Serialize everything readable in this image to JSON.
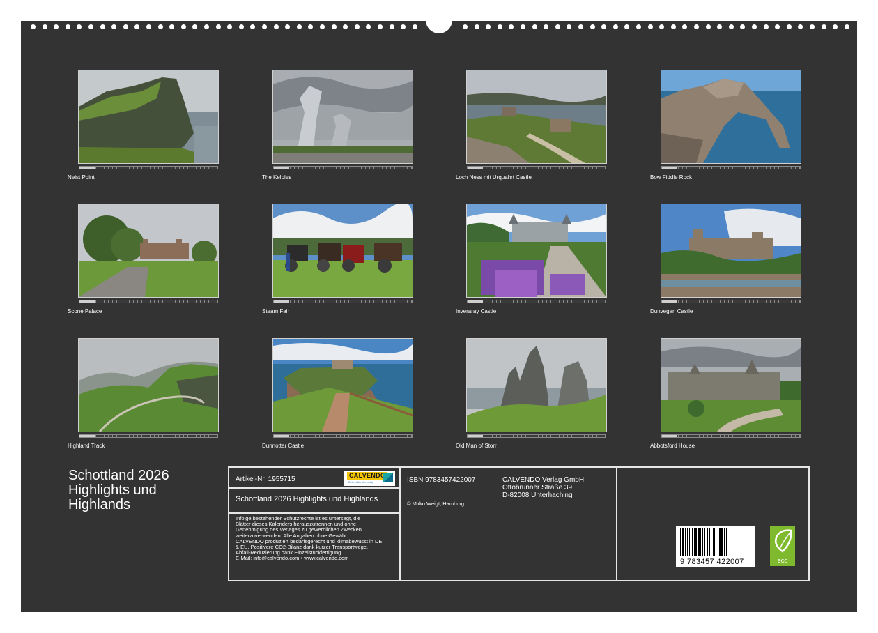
{
  "calendar": {
    "title_lines": [
      "Schottland 2026",
      "Highlights und",
      "Highlands"
    ]
  },
  "months": [
    {
      "caption": "Neist Point"
    },
    {
      "caption": "The Kelpies"
    },
    {
      "caption": "Loch Ness mit Urquahrt Castle"
    },
    {
      "caption": "Bow Fiddle Rock"
    },
    {
      "caption": "Scone Palace"
    },
    {
      "caption": "Steam Fair"
    },
    {
      "caption": "Inveraray Castle"
    },
    {
      "caption": "Dunvegan Castle"
    },
    {
      "caption": "Highland Track"
    },
    {
      "caption": "Dunnottar Castle"
    },
    {
      "caption": "Old Man of Storr"
    },
    {
      "caption": "Abbotsford House"
    }
  ],
  "imprint": {
    "article_no": "Artikel-Nr. 1955715",
    "product_title": "Schottland 2026 Highlights und Highlands",
    "legal_lines": [
      "Infolge bestehender Schutzrechte ist es untersagt, die",
      "Blätter dieses Kalenders herauszutrennen und ohne",
      "Genehmigung des Verlages zu gewerblichen Zwecken",
      "weiterzuverwenden. Alle Angaben ohne Gewähr.",
      "CALVENDO produziert bedarfsgerecht und klimabewusst in DE",
      "& EU. Positivere CO2-Bilanz dank kurzer Transportwege.",
      "Abfall-Reduzierung dank Einzelstückfertigung.",
      "E-Mail: info@calvendo.com • www.calvendo.com"
    ],
    "isbn": "ISBN 9783457422007",
    "copyright": "© Mirko Weigt, Hamburg",
    "publisher_lines": [
      "CALVENDO Verlag GmbH",
      "Ottobrunner Straße 39",
      "D-82008 Unterhaching"
    ],
    "logo_text": "CALVENDO",
    "logo_tagline": "Dein Kalenderverlag",
    "barcode_number": "9 783457 422007",
    "eco_label": "eco"
  },
  "colors": {
    "background": "#333333",
    "text": "#ffffff",
    "border": "#e6e6e6",
    "eco_green": "#7fba2e",
    "logo_yellow": "#f2c400"
  }
}
